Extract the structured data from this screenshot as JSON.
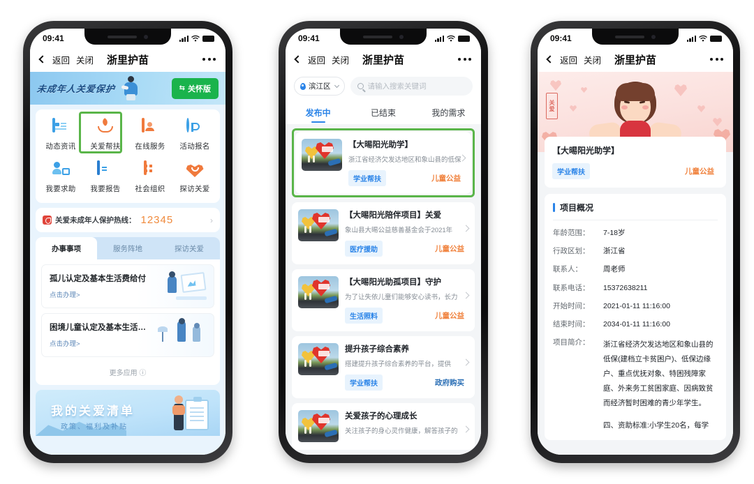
{
  "statusbar": {
    "time": "09:41",
    "signal_icon": "signal-bars-icon",
    "wifi_icon": "wifi-icon",
    "battery_icon": "battery-icon"
  },
  "navbar": {
    "back": "返回",
    "close": "关闭",
    "title": "浙里护苗",
    "more_icon": "more-dots-icon"
  },
  "phone1": {
    "hero": {
      "script_text": "未成年人关爱保护",
      "care_button": "关怀版",
      "swap_icon": "swap-icon"
    },
    "grid": [
      {
        "label": "动态资讯",
        "icon": "news-icon"
      },
      {
        "label": "关爱帮扶",
        "icon": "caring-hands-icon"
      },
      {
        "label": "在线服务",
        "icon": "online-service-icon"
      },
      {
        "label": "活动报名",
        "icon": "sign-up-icon"
      },
      {
        "label": "我要求助",
        "icon": "ask-help-icon"
      },
      {
        "label": "我要报告",
        "icon": "report-icon"
      },
      {
        "label": "社会组织",
        "icon": "organization-icon"
      },
      {
        "label": "探访关爱",
        "icon": "visit-heart-icon"
      }
    ],
    "hotline": {
      "icon": "hotline-badge-icon",
      "label": "关爱未成年人保护热线：",
      "number": "12345",
      "arrow_icon": "chevron-right-icon"
    },
    "tabs": [
      {
        "label": "办事事项",
        "active": true
      },
      {
        "label": "服务阵地",
        "active": false
      },
      {
        "label": "探访关爱",
        "active": false
      }
    ],
    "services": [
      {
        "title": "孤儿认定及基本生活费给付",
        "action": "点击办理>"
      },
      {
        "title": "困境儿童认定及基本生活…",
        "action": "点击办理>"
      }
    ],
    "more": "更多应用 ⓘ",
    "bottom_banner": {
      "title": "我的关爱清单",
      "subtitle": "政策、福利及补贴"
    }
  },
  "phone2": {
    "location": {
      "label": "滨江区",
      "pin_icon": "location-pin-icon",
      "chevron_icon": "chevron-down-icon"
    },
    "search": {
      "placeholder": "请输入搜索关键词",
      "icon": "search-icon"
    },
    "tabs": [
      {
        "label": "发布中",
        "active": true
      },
      {
        "label": "已结束",
        "active": false
      },
      {
        "label": "我的需求",
        "active": false
      }
    ],
    "projects": [
      {
        "title": "【大晹阳光助学】",
        "desc": "浙江省经济欠发达地区和象山县的低保",
        "tag": "学业帮扶",
        "category": "儿童公益",
        "category_style": "orange",
        "highlighted": true
      },
      {
        "title": "【大晹阳光陪伴项目】关爱",
        "desc": "象山县大晹公益慈善基金会于2021年",
        "tag": "医疗援助",
        "category": "儿童公益",
        "category_style": "orange",
        "highlighted": false
      },
      {
        "title": "【大晹阳光助孤项目】守护",
        "desc": "为了让失依儿童们能够安心读书，长力",
        "tag": "生活照料",
        "category": "儿童公益",
        "category_style": "orange",
        "highlighted": false
      },
      {
        "title": "提升孩子综合素养",
        "desc": "搭建提升孩子综合素养的平台，提供",
        "tag": "学业帮扶",
        "category": "政府购买",
        "category_style": "blue",
        "highlighted": false
      },
      {
        "title": "关爱孩子的心理成长",
        "desc": "关注孩子的身心灵作健康，解答孩子的",
        "tag": "",
        "category": "",
        "category_style": "orange",
        "highlighted": false
      }
    ]
  },
  "phone3": {
    "hero": {
      "seal_top": "关",
      "seal_bottom": "爱",
      "alt": "girl-illustration"
    },
    "title": "【大晹阳光助学】",
    "tag": "学业帮扶",
    "category": "儿童公益",
    "section_title": "项目概况",
    "fields": [
      {
        "key": "年龄范围：",
        "value": "7-18岁"
      },
      {
        "key": "行政区划：",
        "value": "浙江省"
      },
      {
        "key": "联系人：",
        "value": "周老师"
      },
      {
        "key": "联系电话：",
        "value": "15372638211"
      },
      {
        "key": "开始时间：",
        "value": "2021-01-11 11:16:00"
      },
      {
        "key": "结束时间：",
        "value": "2034-01-11 11:16:00"
      },
      {
        "key": "项目简介：",
        "value": "浙江省经济欠发达地区和象山县的低保(建档立卡贫困户)、低保边缘户、重点优抚对象、特困残障家庭、外来务工贫困家庭、因病致贫而经济暂时困难的青少年学生。"
      },
      {
        "key": "",
        "value": "四、资助标准:小学生20名，每学"
      }
    ]
  },
  "colors": {
    "highlight_green": "#5ab549",
    "accent_blue": "#2b84e8",
    "accent_orange": "#f0813c",
    "care_button_green": "#1ab34c"
  }
}
